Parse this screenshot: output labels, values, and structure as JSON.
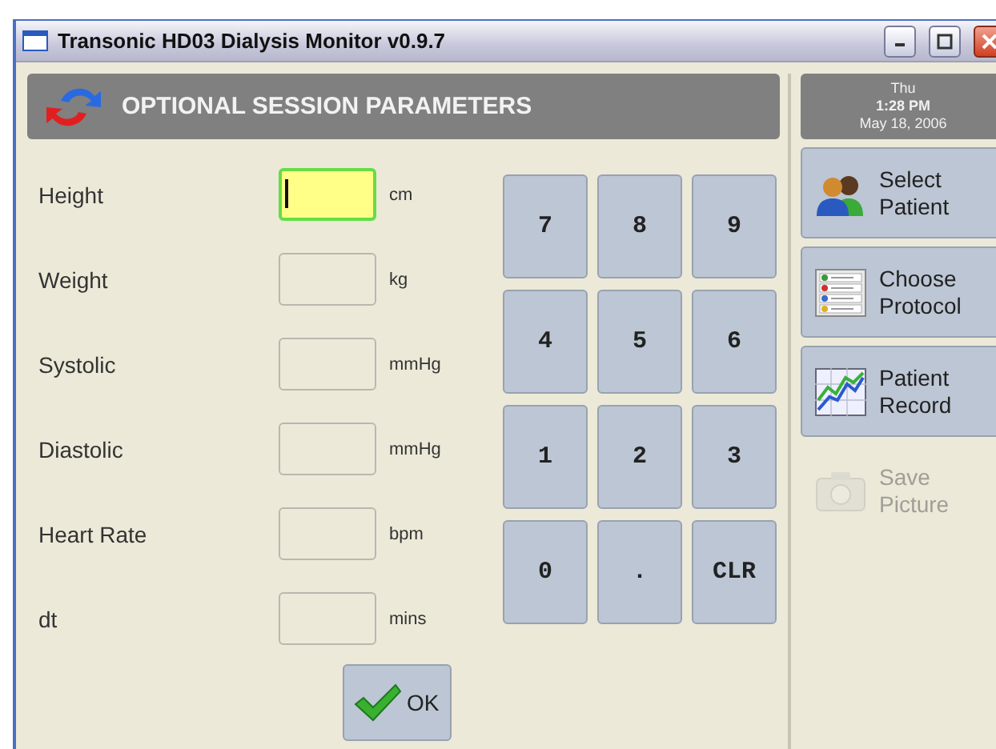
{
  "window": {
    "title": "Transonic HD03 Dialysis Monitor v0.9.7"
  },
  "header": {
    "title": "OPTIONAL SESSION PARAMETERS"
  },
  "clock": {
    "day": "Thu",
    "time": "1:28 PM",
    "date": "May 18, 2006"
  },
  "fields": [
    {
      "label": "Height",
      "unit": "cm",
      "focused": true
    },
    {
      "label": "Weight",
      "unit": "kg",
      "focused": false
    },
    {
      "label": "Systolic",
      "unit": "mmHg",
      "focused": false
    },
    {
      "label": "Diastolic",
      "unit": "mmHg",
      "focused": false
    },
    {
      "label": "Heart Rate",
      "unit": "bpm",
      "focused": false
    },
    {
      "label": "dt",
      "unit": "mins",
      "focused": false
    }
  ],
  "keypad": [
    "7",
    "8",
    "9",
    "4",
    "5",
    "6",
    "1",
    "2",
    "3",
    "0",
    ".",
    "CLR"
  ],
  "ok_button": "OK",
  "side_buttons": [
    {
      "label": "Select Patient",
      "kind": "patient",
      "disabled": false
    },
    {
      "label": "Choose Protocol",
      "kind": "protocol",
      "disabled": false
    },
    {
      "label": "Patient Record",
      "kind": "record",
      "disabled": false
    },
    {
      "label": "Save Picture",
      "kind": "camera",
      "disabled": true
    }
  ]
}
